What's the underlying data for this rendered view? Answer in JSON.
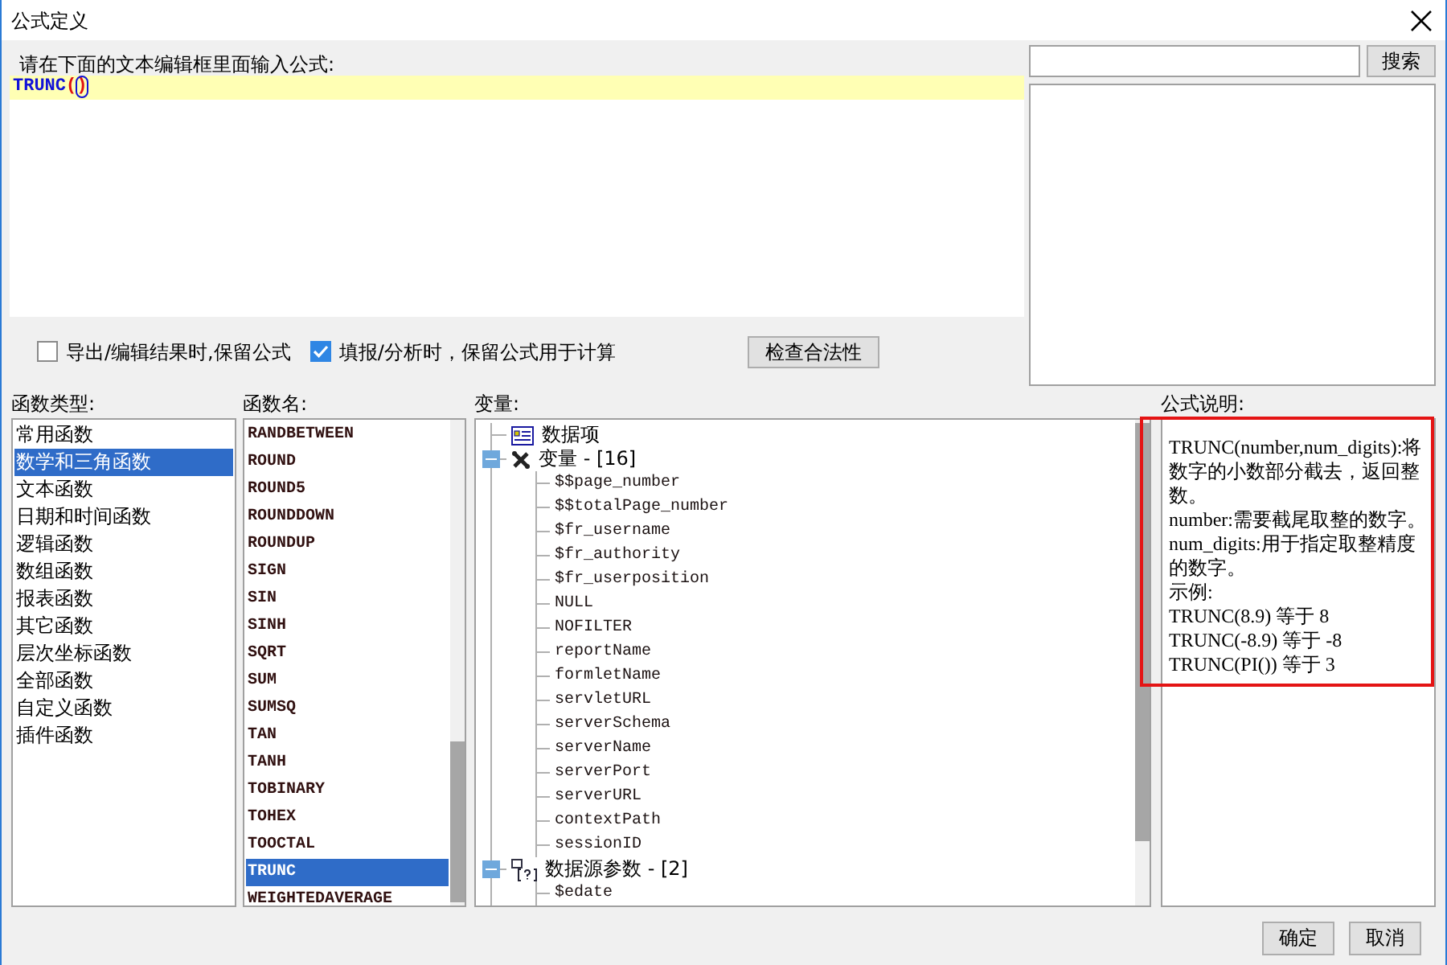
{
  "window": {
    "title": "公式定义"
  },
  "editor": {
    "label": "请在下面的文本编辑框里面输入公式:",
    "tokens": [
      {
        "text": "TRUNC",
        "kind": "function"
      },
      {
        "text": "(",
        "kind": "paren"
      },
      {
        "text": ")",
        "kind": "matched-paren"
      }
    ]
  },
  "options": [
    {
      "label": "导出/编辑结果时,保留公式",
      "checked": false
    },
    {
      "label": "填报/分析时，保留公式用于计算",
      "checked": true
    }
  ],
  "check_button": "检查合法性",
  "search": {
    "button": "搜索"
  },
  "function_types": {
    "label": "函数类型:",
    "items": [
      {
        "label": "常用函数",
        "selected": false
      },
      {
        "label": "数学和三角函数",
        "selected": true
      },
      {
        "label": "文本函数",
        "selected": false
      },
      {
        "label": "日期和时间函数",
        "selected": false
      },
      {
        "label": "逻辑函数",
        "selected": false
      },
      {
        "label": "数组函数",
        "selected": false
      },
      {
        "label": "报表函数",
        "selected": false
      },
      {
        "label": "其它函数",
        "selected": false
      },
      {
        "label": "层次坐标函数",
        "selected": false
      },
      {
        "label": "全部函数",
        "selected": false
      },
      {
        "label": "自定义函数",
        "selected": false
      },
      {
        "label": "插件函数",
        "selected": false
      }
    ]
  },
  "function_names": {
    "label": "函数名:",
    "items": [
      {
        "label": "RANDBETWEEN",
        "selected": false
      },
      {
        "label": "ROUND",
        "selected": false
      },
      {
        "label": "ROUND5",
        "selected": false
      },
      {
        "label": "ROUNDDOWN",
        "selected": false
      },
      {
        "label": "ROUNDUP",
        "selected": false
      },
      {
        "label": "SIGN",
        "selected": false
      },
      {
        "label": "SIN",
        "selected": false
      },
      {
        "label": "SINH",
        "selected": false
      },
      {
        "label": "SQRT",
        "selected": false
      },
      {
        "label": "SUM",
        "selected": false
      },
      {
        "label": "SUMSQ",
        "selected": false
      },
      {
        "label": "TAN",
        "selected": false
      },
      {
        "label": "TANH",
        "selected": false
      },
      {
        "label": "TOBINARY",
        "selected": false
      },
      {
        "label": "TOHEX",
        "selected": false
      },
      {
        "label": "TOOCTAL",
        "selected": false
      },
      {
        "label": "TRUNC",
        "selected": true
      },
      {
        "label": "WEIGHTEDAVERAGE",
        "selected": false
      }
    ]
  },
  "variables": {
    "label": "变量:",
    "tree": [
      {
        "label": "数据项",
        "kind": "data-item"
      },
      {
        "label": "变量 - [16]",
        "kind": "variable-group",
        "expanded": true,
        "children": [
          {
            "label": "$$page_number"
          },
          {
            "label": "$$totalPage_number"
          },
          {
            "label": "$fr_username"
          },
          {
            "label": "$fr_authority"
          },
          {
            "label": "$fr_userposition"
          },
          {
            "label": "NULL"
          },
          {
            "label": "NOFILTER"
          },
          {
            "label": "reportName"
          },
          {
            "label": "formletName"
          },
          {
            "label": "servletURL"
          },
          {
            "label": "serverSchema"
          },
          {
            "label": "serverName"
          },
          {
            "label": "serverPort"
          },
          {
            "label": "serverURL"
          },
          {
            "label": "contextPath"
          },
          {
            "label": "sessionID"
          }
        ]
      },
      {
        "label": "数据源参数 - [2]",
        "kind": "parameter-group",
        "expanded": true,
        "children": [
          {
            "label": "$edate"
          }
        ]
      }
    ]
  },
  "description": {
    "label": "公式说明:",
    "lines": [
      "TRUNC(number,num_digits):将数字的小数部分截去，返回整数。",
      "number:需要截尾取整的数字。",
      "num_digits:用于指定取整精度的数字。",
      "示例:",
      "TRUNC(8.9) 等于 8",
      "TRUNC(-8.9) 等于 -8",
      "TRUNC(PI()) 等于 3"
    ]
  },
  "buttons": [
    "确定",
    "取消"
  ]
}
